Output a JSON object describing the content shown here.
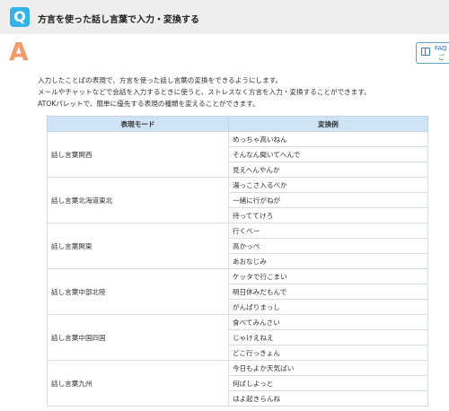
{
  "question": {
    "badge": "Q",
    "text": "方言を使った話し言葉で入力・変換する"
  },
  "answer": {
    "badge": "A",
    "intro": [
      "入力したことばの表現で、方言を使った話し言葉の変換をできるようにします。",
      "メールやチャットなどで会話を入力するときに使うと、ストレスなく方言を入力・変換することができます。",
      "ATOKパレットで、簡単に優先する表現の種類を変えることができます。"
    ]
  },
  "faq_button": {
    "icon": "book-icon",
    "line1": "FAQ",
    "line2": "ご"
  },
  "table": {
    "headers": [
      "表現モード",
      "変換例"
    ],
    "groups": [
      {
        "mode": "話し言葉関西",
        "examples": [
          "めっちゃ高いねん",
          "そんなん聞いてへんで",
          "見えへんやんか"
        ]
      },
      {
        "mode": "話し言葉北海道東北",
        "examples": [
          "湯っこさ入るべか",
          "一緒に行がねが",
          "待っててけろ"
        ]
      },
      {
        "mode": "話し言葉関東",
        "examples": [
          "行くべー",
          "高かっぺ",
          "あおなじみ"
        ]
      },
      {
        "mode": "話し言葉中部北陸",
        "examples": [
          "ケッタで行こまい",
          "明日休みだもんで",
          "がんばりまっし"
        ]
      },
      {
        "mode": "話し言葉中国四国",
        "examples": [
          "食べてみんさい",
          "じゃけえねえ",
          "どこ行っきょん"
        ]
      },
      {
        "mode": "話し言葉九州",
        "examples": [
          "今日もよか天気ばい",
          "何ばしよっと",
          "はよ起きらんね"
        ]
      }
    ]
  },
  "colors": {
    "q_badge": "#33b3ea",
    "a_badge": "#f39a6b",
    "header_bg": "#cfe3f6",
    "link": "#1e6bb8"
  }
}
